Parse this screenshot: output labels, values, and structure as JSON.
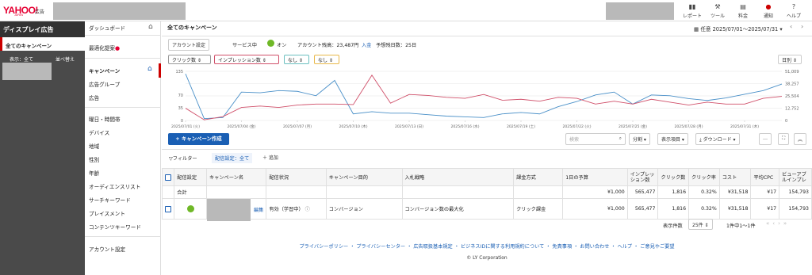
{
  "brand": {
    "logo": "YAHOO!",
    "logo_sub": "JAPAN",
    "logo_suffix": "広告"
  },
  "topnav": [
    {
      "label": "レポート",
      "icon": "chart-icon"
    },
    {
      "label": "ツール",
      "icon": "wrench-icon"
    },
    {
      "label": "料金",
      "icon": "billing-icon"
    },
    {
      "label": "通知",
      "icon": "bell-icon"
    },
    {
      "label": "ヘルプ",
      "icon": "help-icon"
    }
  ],
  "left": {
    "header": "ディスプレイ広告",
    "all_campaigns": "全てのキャンペーン",
    "display_label": "表示：全て",
    "sort_label": "並べ替え"
  },
  "nav": {
    "dashboard": "ダッシュボード",
    "optimize": "最適化提案",
    "campaign": "キャンペーン",
    "adgroup": "広告グループ",
    "ad": "広告",
    "dayhour": "曜日・時間帯",
    "device": "デバイス",
    "region": "地域",
    "gender": "性別",
    "age": "年齢",
    "audience": "オーディエンスリスト",
    "search_kw": "サーチキーワード",
    "placement": "プレイスメント",
    "content_kw": "コンテンツキーワード",
    "account": "アカウント設定"
  },
  "main": {
    "title": "全てのキャンペーン",
    "date_range": "任意 2025/07/01〜2025/07/31",
    "account_settings": "アカウント設定",
    "service_label": "サービス中",
    "status": "オン",
    "balance": "アカウント残高：23,487円",
    "deposit": "入金",
    "days_left": "予想残日数：25日",
    "metric_chips": [
      "クリック数",
      "インプレッション数",
      "なし",
      "なし"
    ],
    "period": "日別",
    "create_btn": "+ キャンペーン作成",
    "search_placeholder": "検索",
    "toolbar": [
      "分割",
      "表示項目",
      "ダウンロード",
      "…"
    ],
    "filter": "フィルター",
    "filter_value": "配信設定：全て",
    "add": "＋ 追加"
  },
  "chart_data": {
    "type": "line",
    "x_ticks": [
      "2025/07/01 (火)",
      "2025/07/04 (金)",
      "2025/07/07 (月)",
      "2025/07/10 (木)",
      "2025/07/13 (日)",
      "2025/07/16 (水)",
      "2025/07/19 (土)",
      "2025/07/22 (火)",
      "2025/07/25 (金)",
      "2025/07/28 (月)",
      "2025/07/31 (木)"
    ],
    "y_left_ticks": [
      "135",
      "70",
      "35",
      "0"
    ],
    "y_right_ticks": [
      "51,009",
      "38,257",
      "25,504",
      "12,752",
      "0"
    ],
    "ylim_left": [
      0,
      135
    ],
    "ylim_right": [
      0,
      51009
    ],
    "series": [
      {
        "name": "クリック数",
        "color": "#4a90c8",
        "axis": "left",
        "values": [
          128,
          5,
          8,
          78,
          76,
          82,
          80,
          68,
          110,
          18,
          24,
          20,
          20,
          16,
          12,
          10,
          8,
          18,
          22,
          18,
          38,
          52,
          70,
          78,
          45,
          70,
          68,
          60,
          55,
          62,
          72,
          82,
          100
        ]
      },
      {
        "name": "インプレッション数",
        "color": "#d0506a",
        "axis": "right",
        "values": [
          12700,
          700,
          4000,
          13500,
          15000,
          13500,
          16000,
          17000,
          17000,
          16500,
          47000,
          18000,
          27000,
          26000,
          24000,
          23000,
          27000,
          21000,
          22000,
          20000,
          24000,
          23000,
          17000,
          20000,
          17000,
          22000,
          19000,
          16000,
          19000,
          17000,
          17000,
          23000,
          25000
        ]
      }
    ]
  },
  "table": {
    "headers": [
      "配信設定",
      "キャンペーン名",
      "配信状況",
      "キャンペーン目的",
      "入札戦略",
      "課金方式",
      "1日の予算",
      "インプレッション数",
      "クリック数",
      "クリック率",
      "コスト",
      "平均CPC",
      "ビューアブルインプレ"
    ],
    "total": {
      "label": "合計",
      "budget": "¥1,000",
      "impressions": "565,477",
      "clicks": "1,816",
      "ctr": "0.32%",
      "cost": "¥31,518",
      "cpc": "¥17",
      "viewable": "154,793"
    },
    "rows": [
      {
        "edit": "編集",
        "status": "有効（学習中）",
        "goal": "コンバージョン",
        "bid": "コンバージョン数の最大化",
        "billing": "クリック課金",
        "budget": "¥1,000",
        "impressions": "565,477",
        "clicks": "1,816",
        "ctr": "0.32%",
        "cost": "¥31,518",
        "cpc": "¥17",
        "viewable": "154,793"
      }
    ]
  },
  "pagination": {
    "label": "表示件数",
    "per_page": "25件",
    "range": "1件中1〜1件"
  },
  "footer": {
    "links": [
      "プライバシーポリシー",
      "プライバシーセンター",
      "広告取扱基本規定",
      "ビジネスIDに関する利用規約について",
      "免責事項",
      "お問い合わせ",
      "ヘルプ",
      "ご意見やご要望"
    ],
    "copyright": "© LY Corporation"
  }
}
